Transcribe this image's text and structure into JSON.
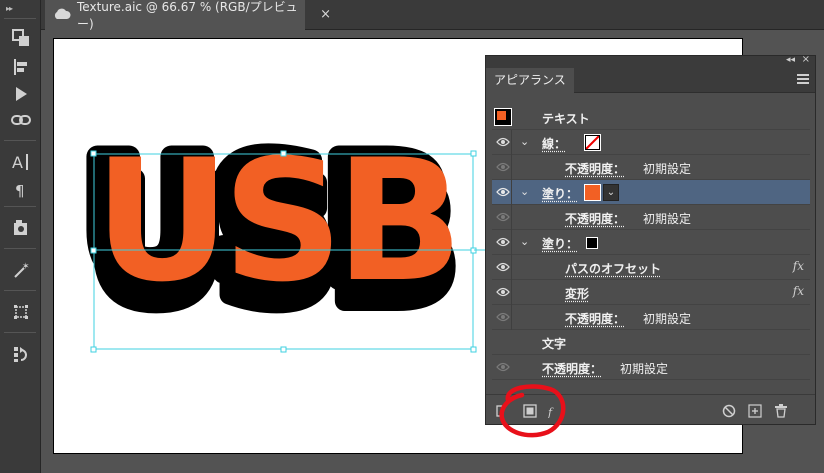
{
  "tab": {
    "title": "Texture.aic @ 66.67 % (RGB/プレビュー)",
    "close": "×"
  },
  "toolbar": {
    "grip": "▸▸",
    "tools": [
      "artboards-icon",
      "align-icon",
      "play-icon",
      "link-icon",
      "type-icon",
      "paragraph-icon",
      "symbol-icon",
      "magic-wand-icon",
      "transform-icon",
      "actions-icon"
    ]
  },
  "artwork": {
    "text": "USB",
    "fill": "#f26024",
    "stroke": "#000000"
  },
  "panel": {
    "tab": "アピアランス",
    "header": "テキスト",
    "rows": [
      {
        "label": "線：",
        "kind": "stroke-swatch"
      },
      {
        "label": "不透明度：",
        "value": "初期設定"
      },
      {
        "label": "塗り：",
        "swatch_color": "#f26024"
      },
      {
        "label": "不透明度：",
        "value": "初期設定"
      },
      {
        "label": "塗り：",
        "swatch_color": "#000000"
      },
      {
        "label": "パスのオフセット",
        "fx": "fx"
      },
      {
        "label": "変形",
        "fx": "fx"
      },
      {
        "label": "不透明度：",
        "value": "初期設定"
      },
      {
        "label": "文字"
      },
      {
        "label": "不透明度：",
        "value": "初期設定"
      }
    ]
  },
  "colors": {
    "accent_selected": "#4f6582",
    "annotation": "#e8101a"
  }
}
